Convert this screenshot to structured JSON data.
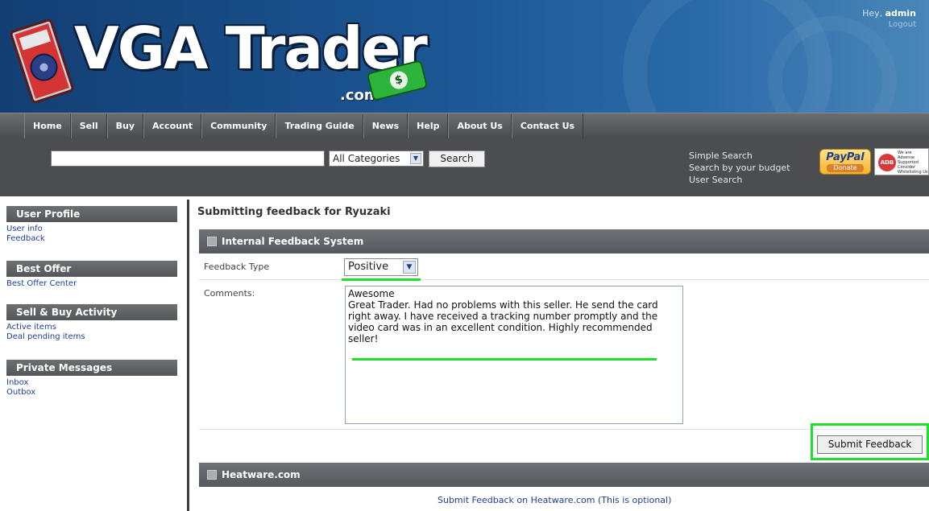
{
  "header": {
    "logo_text": "VGA Trader",
    "logo_suffix": ".com",
    "greeting": "Hey,",
    "username": "admin",
    "logout": "Logout"
  },
  "nav": {
    "items": [
      "Home",
      "Sell",
      "Buy",
      "Account",
      "Community",
      "Trading Guide",
      "News",
      "Help",
      "About Us",
      "Contact Us"
    ]
  },
  "search": {
    "input_value": "",
    "category": "All Categories",
    "button": "Search",
    "links": [
      "Simple Search",
      "Search by your budget",
      "User Search"
    ],
    "paypal_label": "PayPal",
    "paypal_sub": "Donate",
    "badge_text": "We are Adsense Supported Consider Whitelisting Us"
  },
  "sidebar": {
    "sections": [
      {
        "title": "User Profile",
        "links": [
          "User info",
          "Feedback"
        ]
      },
      {
        "title": "Best Offer",
        "links": [
          "Best Offer Center"
        ]
      },
      {
        "title": "Sell & Buy Activity",
        "links": [
          "Active items",
          "Deal pending items"
        ]
      },
      {
        "title": "Private Messages",
        "links": [
          "Inbox",
          "Outbox"
        ]
      }
    ]
  },
  "main": {
    "page_title": "Submitting feedback for Ryuzaki",
    "panel1_title": "Internal Feedback System",
    "feedback_type_label": "Feedback Type",
    "feedback_type_value": "Positive",
    "comments_label": "Comments:",
    "comments_value": "Awesome\nGreat Trader. Had no problems with this seller. He send the card right away. I have received a tracking number promptly and the video card was in an excellent condition. Highly recommended seller!",
    "submit_label": "Submit Feedback",
    "panel2_title": "Heatware.com",
    "heatware_link": "Submit Feedback on Heatware.com (This is optional)"
  },
  "colors": {
    "highlight": "#21e02c",
    "link": "#1b3f9c",
    "banner": "#1b5592"
  }
}
